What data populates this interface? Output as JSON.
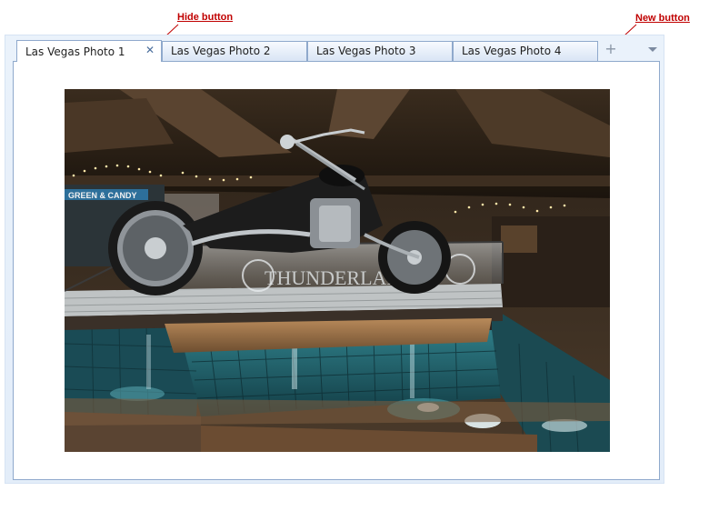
{
  "callouts": {
    "hide_button": "Hide button",
    "new_button": "New button"
  },
  "tabs": [
    {
      "label": "Las Vegas Photo 1",
      "active": true
    },
    {
      "label": "Las Vegas Photo 2",
      "active": false
    },
    {
      "label": "Las Vegas Photo 3",
      "active": false
    },
    {
      "label": "Las Vegas Photo 4",
      "active": false
    }
  ],
  "icons": {
    "close": "close-icon",
    "new_tab": "plus-icon",
    "tab_list": "chevron-down-icon"
  },
  "photo": {
    "sign_text": "GREEN & CANDY",
    "bike_text": "THUNDERLAK"
  },
  "colors": {
    "callout": "#c00000",
    "tab_border": "#8fa9cc",
    "pool_water": "#1f5a63"
  }
}
